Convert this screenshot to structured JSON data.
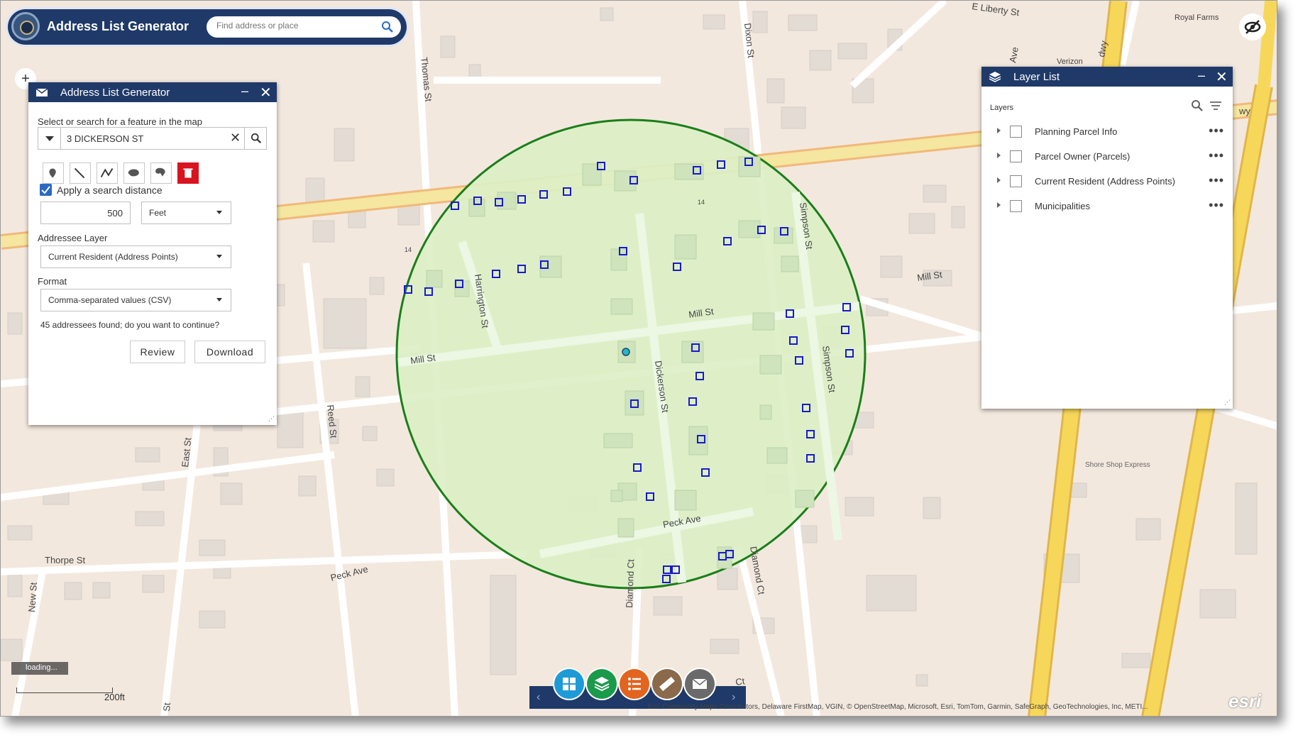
{
  "header": {
    "app_title": "Address List Generator",
    "search_placeholder": "Find address or place"
  },
  "map": {
    "streets": [
      "E Liberty St",
      "Dixon St",
      "Thomas St",
      "Ave",
      "dwy",
      "Royal Farms",
      "Verizon",
      "wy",
      "Mill St",
      "Mill St",
      "Mill St",
      "Harrington St",
      "Simpson St",
      "Simpson St",
      "Dickerson St",
      "Reed St",
      "East St",
      "Peck Ave",
      "Peck Ave",
      "Diamond Ct",
      "Diamond Ct",
      "Thorpe St",
      "New St",
      "St",
      "Ct",
      "14",
      "14",
      "Shore Shop Express"
    ],
    "circle_color": "#1a7f1a",
    "parcel_marker_color": "#1a1acc"
  },
  "address_panel": {
    "title": "Address List Generator",
    "select_label": "Select or search for a feature in the map",
    "search_value": "3 DICKERSON ST",
    "apply_distance_label": "Apply a search distance",
    "distance_value": "500",
    "distance_unit": "Feet",
    "addressee_layer_label": "Addressee Layer",
    "addressee_layer_value": "Current Resident (Address Points)",
    "format_label": "Format",
    "format_value": "Comma-separated values (CSV)",
    "found_text": "45 addressees found; do you want to continue?",
    "review_label": "Review",
    "download_label": "Download"
  },
  "layer_panel": {
    "title": "Layer List",
    "layers_heading": "Layers",
    "layers": [
      {
        "name": "Planning Parcel Info"
      },
      {
        "name": "Parcel Owner (Parcels)"
      },
      {
        "name": "Current Resident (Address Points)"
      },
      {
        "name": "Municipalities"
      }
    ]
  },
  "status": {
    "loading_text": "loading...",
    "scale_label": "200ft",
    "attribution": "Esri Community Maps Contributors, Delaware FirstMap, VGIN, © OpenStreetMap, Microsoft, Esri, TomTom, Garmin, SafeGraph, GeoTechnologies, Inc, METI...",
    "esri_logo": "esri"
  },
  "dock": {
    "buttons": [
      {
        "icon": "grid-icon",
        "color": "#1e9ad6"
      },
      {
        "icon": "layers-icon",
        "color": "#1a9a4a"
      },
      {
        "icon": "list-icon",
        "color": "#e2641e"
      },
      {
        "icon": "ruler-icon",
        "color": "#8a6a4a"
      },
      {
        "icon": "envelope-icon",
        "color": "#6a6a6a"
      }
    ]
  }
}
